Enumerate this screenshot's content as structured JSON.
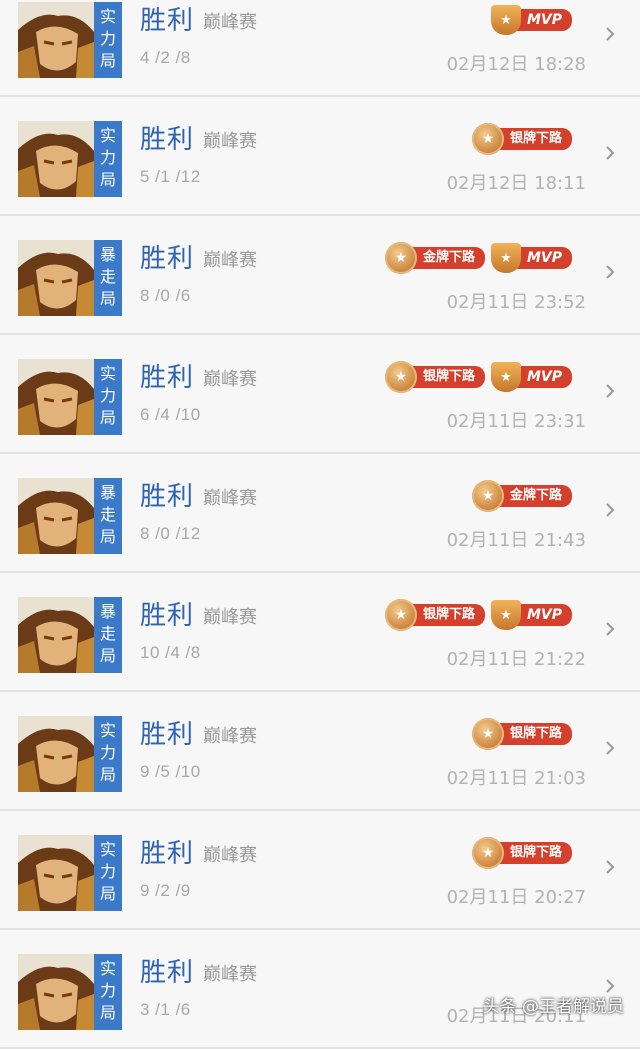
{
  "matches": [
    {
      "mode": [
        "实",
        "力",
        "局"
      ],
      "result": "胜利",
      "type": "巅峰赛",
      "kda": "4 /2 /8",
      "time": "02月12日  18:28",
      "badges": [
        {
          "kind": "mvp",
          "label": "MVP"
        }
      ]
    },
    {
      "mode": [
        "实",
        "力",
        "局"
      ],
      "result": "胜利",
      "type": "巅峰赛",
      "kda": "5 /1 /12",
      "time": "02月12日  18:11",
      "badges": [
        {
          "kind": "medal",
          "label": "银牌下路"
        }
      ]
    },
    {
      "mode": [
        "暴",
        "走",
        "局"
      ],
      "result": "胜利",
      "type": "巅峰赛",
      "kda": "8 /0 /6",
      "time": "02月11日  23:52",
      "badges": [
        {
          "kind": "medal",
          "label": "金牌下路"
        },
        {
          "kind": "mvp",
          "label": "MVP"
        }
      ]
    },
    {
      "mode": [
        "实",
        "力",
        "局"
      ],
      "result": "胜利",
      "type": "巅峰赛",
      "kda": "6 /4 /10",
      "time": "02月11日  23:31",
      "badges": [
        {
          "kind": "medal",
          "label": "银牌下路"
        },
        {
          "kind": "mvp",
          "label": "MVP"
        }
      ]
    },
    {
      "mode": [
        "暴",
        "走",
        "局"
      ],
      "result": "胜利",
      "type": "巅峰赛",
      "kda": "8 /0 /12",
      "time": "02月11日  21:43",
      "badges": [
        {
          "kind": "medal",
          "label": "金牌下路"
        }
      ]
    },
    {
      "mode": [
        "暴",
        "走",
        "局"
      ],
      "result": "胜利",
      "type": "巅峰赛",
      "kda": "10 /4 /8",
      "time": "02月11日  21:22",
      "badges": [
        {
          "kind": "medal",
          "label": "银牌下路"
        },
        {
          "kind": "mvp",
          "label": "MVP"
        }
      ]
    },
    {
      "mode": [
        "实",
        "力",
        "局"
      ],
      "result": "胜利",
      "type": "巅峰赛",
      "kda": "9 /5 /10",
      "time": "02月11日  21:03",
      "badges": [
        {
          "kind": "medal",
          "label": "银牌下路"
        }
      ]
    },
    {
      "mode": [
        "实",
        "力",
        "局"
      ],
      "result": "胜利",
      "type": "巅峰赛",
      "kda": "9 /2 /9",
      "time": "02月11日  20:27",
      "badges": [
        {
          "kind": "medal",
          "label": "银牌下路"
        }
      ]
    },
    {
      "mode": [
        "实",
        "力",
        "局"
      ],
      "result": "胜利",
      "type": "巅峰赛",
      "kda": "3 /1 /6",
      "time": "02月11日  20:11",
      "badges": []
    }
  ],
  "watermark": "头条 @王者解说员",
  "colors": {
    "mode_bg": "#3b79c9",
    "result": "#2f63b3",
    "ribbon": "#d5402c"
  },
  "icons": {
    "chevron": "chevron-right-icon",
    "medal": "medal-icon",
    "mvp": "trophy-icon"
  }
}
